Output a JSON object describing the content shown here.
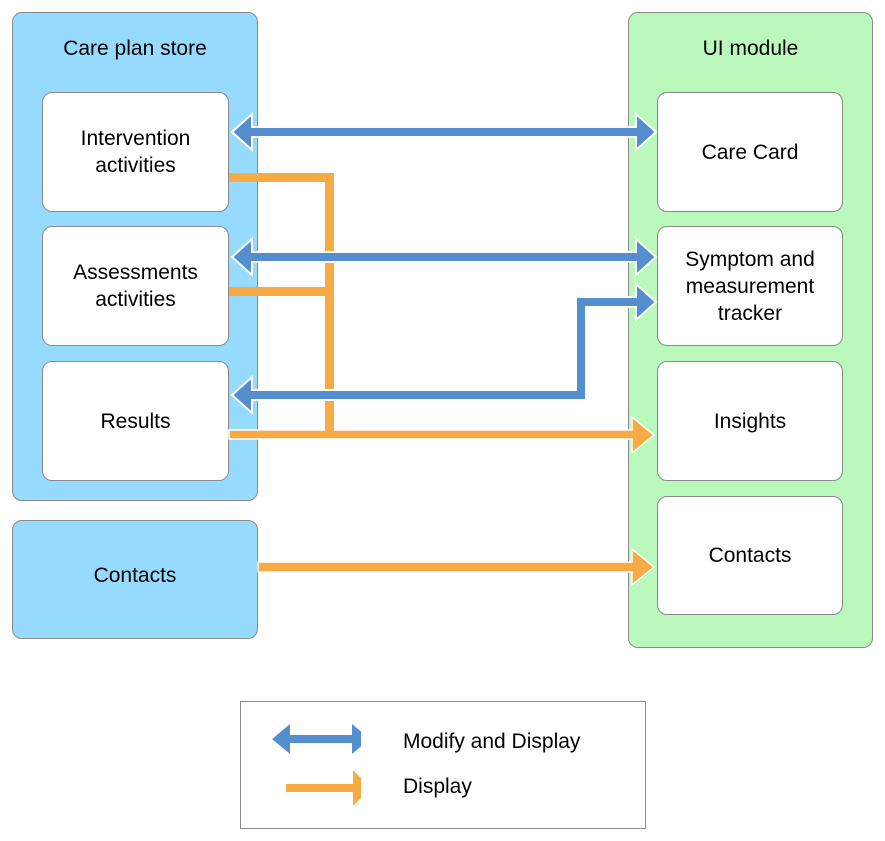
{
  "colors": {
    "store_fill": "#96dbff",
    "ui_fill": "#baf8bb",
    "modify_display": "#558ecf",
    "display": "#f8aa44"
  },
  "store": {
    "title": "Care plan store",
    "items": [
      {
        "label": "Intervention activities",
        "lines": [
          "Intervention",
          "activities"
        ]
      },
      {
        "label": "Assessments activities",
        "lines": [
          "Assessments",
          "activities"
        ]
      },
      {
        "label": "Results",
        "lines": [
          "Results"
        ]
      }
    ]
  },
  "contacts_source": {
    "label": "Contacts"
  },
  "ui_module": {
    "title": "UI module",
    "items": [
      {
        "label": "Care Card",
        "lines": [
          "Care Card"
        ]
      },
      {
        "label": "Symptom and measurement tracker",
        "lines": [
          "Symptom and",
          "measurement",
          "tracker"
        ]
      },
      {
        "label": "Insights",
        "lines": [
          "Insights"
        ]
      },
      {
        "label": "Contacts",
        "lines": [
          "Contacts"
        ]
      }
    ]
  },
  "connections": [
    {
      "from": "Intervention activities",
      "to": "Care Card",
      "type": "modify_display"
    },
    {
      "from": "Assessments activities",
      "to": "Symptom and measurement tracker",
      "type": "modify_display"
    },
    {
      "from": "Results",
      "to": "Symptom and measurement tracker",
      "type": "modify_display"
    },
    {
      "from": "Intervention activities",
      "to": "Insights",
      "type": "display"
    },
    {
      "from": "Assessments activities",
      "to": "Insights",
      "type": "display"
    },
    {
      "from": "Results",
      "to": "Insights",
      "type": "display"
    },
    {
      "from": "Contacts (store)",
      "to": "Contacts (UI)",
      "type": "display"
    }
  ],
  "legend": {
    "modify_display": "Modify and Display",
    "display": "Display"
  }
}
